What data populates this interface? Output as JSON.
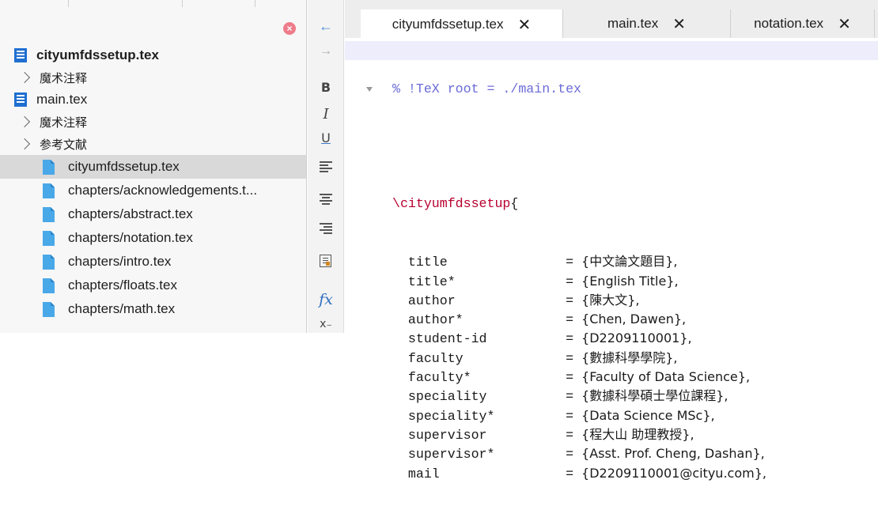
{
  "sidebar": {
    "close_icon": "×",
    "items": [
      {
        "type": "root",
        "label": "cityumfdssetup.tex",
        "bold": true
      },
      {
        "type": "magic",
        "label": "魔术注释"
      },
      {
        "type": "root",
        "label": "main.tex",
        "bold": false
      },
      {
        "type": "magic",
        "label": "魔术注释"
      },
      {
        "type": "magic",
        "label": "参考文献"
      },
      {
        "type": "file",
        "label": "cityumfdssetup.tex",
        "selected": true
      },
      {
        "type": "file",
        "label": "chapters/acknowledgements.t..."
      },
      {
        "type": "file",
        "label": "chapters/abstract.tex"
      },
      {
        "type": "file",
        "label": "chapters/notation.tex"
      },
      {
        "type": "file",
        "label": "chapters/intro.tex"
      },
      {
        "type": "file",
        "label": "chapters/floats.tex"
      },
      {
        "type": "file",
        "label": "chapters/math.tex"
      }
    ]
  },
  "gutter": {
    "back": "←",
    "forward": "→",
    "bold": "B",
    "italic": "I",
    "underline": "U",
    "fx": "fx",
    "subscript": "x₋"
  },
  "tabs": [
    {
      "label": "cityumfdssetup.tex",
      "active": true
    },
    {
      "label": "main.tex",
      "active": false
    },
    {
      "label": "notation.tex",
      "active": false
    }
  ],
  "tab_close": "✕",
  "colors": {
    "accent": "#1f6fd1",
    "comment": "#6b6bd6",
    "keyword": "#b8002e",
    "selection": "#d9d9d9"
  },
  "editor": {
    "comment_line": "% !TeX root = ./main.tex",
    "command": "\\cityumfdssetup",
    "open_brace": "{",
    "fields": [
      {
        "key": "title",
        "value": "{中文論文題目},"
      },
      {
        "key": "title*",
        "value": "{English Title},"
      },
      {
        "key": "author",
        "value": "{陳大文},"
      },
      {
        "key": "author*",
        "value": "{Chen, Dawen},"
      },
      {
        "key": "student-id",
        "value": "{D2209110001},"
      },
      {
        "key": "faculty",
        "value": "{數據科學學院},"
      },
      {
        "key": "faculty*",
        "value": "{Faculty of Data Science},"
      },
      {
        "key": "speciality",
        "value": "{數據科學碩士學位課程},"
      },
      {
        "key": "speciality*",
        "value": "{Data Science MSc},"
      },
      {
        "key": "supervisor",
        "value": "{程大山 助理教授},"
      },
      {
        "key": "supervisor*",
        "value": "{Asst. Prof. Cheng, Dashan},"
      },
      {
        "key": "mail",
        "value": "{D2209110001@cityu.com},"
      }
    ]
  }
}
